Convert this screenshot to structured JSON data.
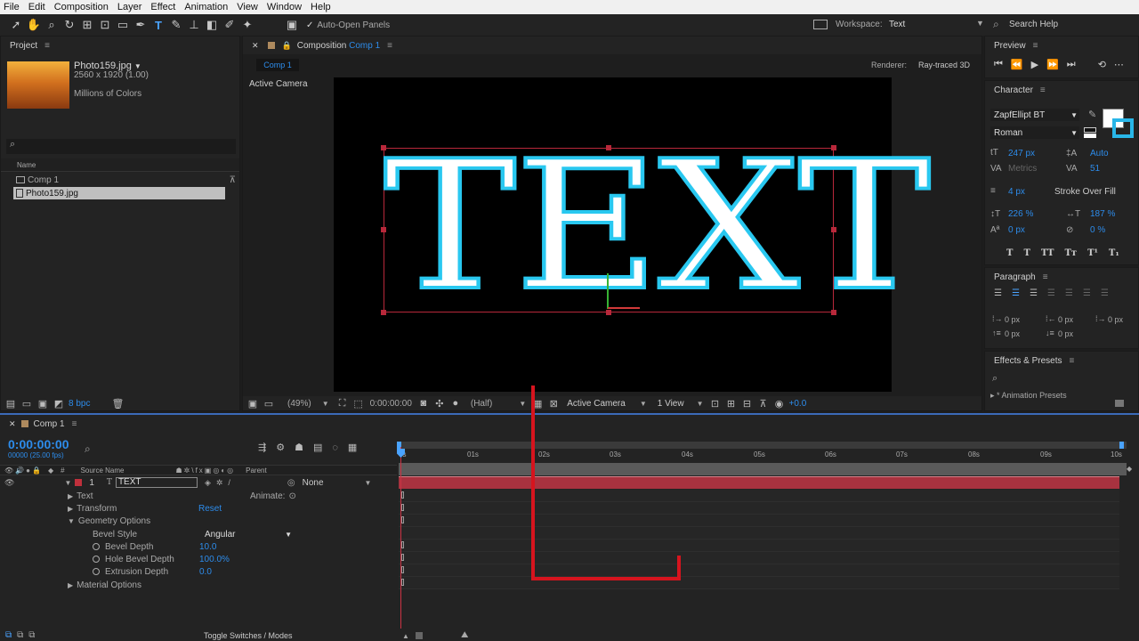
{
  "menu": [
    "File",
    "Edit",
    "Composition",
    "Layer",
    "Effect",
    "Animation",
    "View",
    "Window",
    "Help"
  ],
  "toolbar": {
    "auto_open": "Auto-Open Panels",
    "workspace_label": "Workspace:",
    "workspace_value": "Text",
    "search": "Search Help"
  },
  "project": {
    "title": "Project",
    "file_name": "Photo159.jpg",
    "dims": "2560 x 1920 (1.00)",
    "colors": "Millions of Colors",
    "col_name": "Name",
    "items": [
      "Comp 1",
      "Photo159.jpg"
    ],
    "bpc": "8 bpc"
  },
  "comp": {
    "tab_label": "Composition",
    "tab_comp": "Comp 1",
    "breadcrumb": "Comp 1",
    "renderer_label": "Renderer:",
    "renderer_value": "Ray-traced 3D",
    "active_camera": "Active Camera",
    "text": "TEXT",
    "bottom": {
      "zoom": "(49%)",
      "timecode": "0:00:00:00",
      "resolution": "(Half)",
      "camera": "Active Camera",
      "views": "1 View",
      "exposure": "+0.0"
    }
  },
  "preview": {
    "title": "Preview"
  },
  "character": {
    "title": "Character",
    "font": "ZapfEllipt BT",
    "style": "Roman",
    "size": "247 px",
    "leading": "Auto",
    "kerning": "Metrics",
    "tracking": "51",
    "stroke_width": "4 px",
    "stroke_mode": "Stroke Over Fill",
    "vscale": "226 %",
    "hscale": "187 %",
    "baseline": "0 px",
    "tsume": "0 %",
    "fill_color": "#ffffff",
    "stroke_color": "#29b6e8"
  },
  "paragraph": {
    "title": "Paragraph",
    "indents": [
      "0 px",
      "0 px",
      "0 px",
      "0 px",
      "0 px"
    ]
  },
  "effects": {
    "title": "Effects & Presets",
    "item": "* Animation Presets"
  },
  "timeline": {
    "tab": "Comp 1",
    "timecode": "0:00:00:00",
    "fps": "00000 (25.00 fps)",
    "col_source": "Source Name",
    "col_parent": "Parent",
    "layer_num": "1",
    "layer_name": "TEXT",
    "parent_value": "None",
    "ruler": [
      "0s",
      "01s",
      "02s",
      "03s",
      "04s",
      "05s",
      "06s",
      "07s",
      "08s",
      "09s",
      "10s"
    ],
    "props": {
      "text": "Text",
      "animate": "Animate:",
      "transform": "Transform",
      "reset": "Reset",
      "geometry": "Geometry Options",
      "bevel_style": "Bevel Style",
      "bevel_style_value": "Angular",
      "bevel_depth": "Bevel Depth",
      "bevel_depth_value": "10.0",
      "hole_bevel": "Hole Bevel Depth",
      "hole_bevel_value": "100.0%",
      "extrusion": "Extrusion Depth",
      "extrusion_value": "0.0",
      "material": "Material Options"
    },
    "toggle": "Toggle Switches / Modes"
  },
  "colors": {
    "accent": "#2d8ceb",
    "layer_bar": "#a8323f",
    "annotation": "#d6141e",
    "text_stroke": "#29c8f0"
  }
}
